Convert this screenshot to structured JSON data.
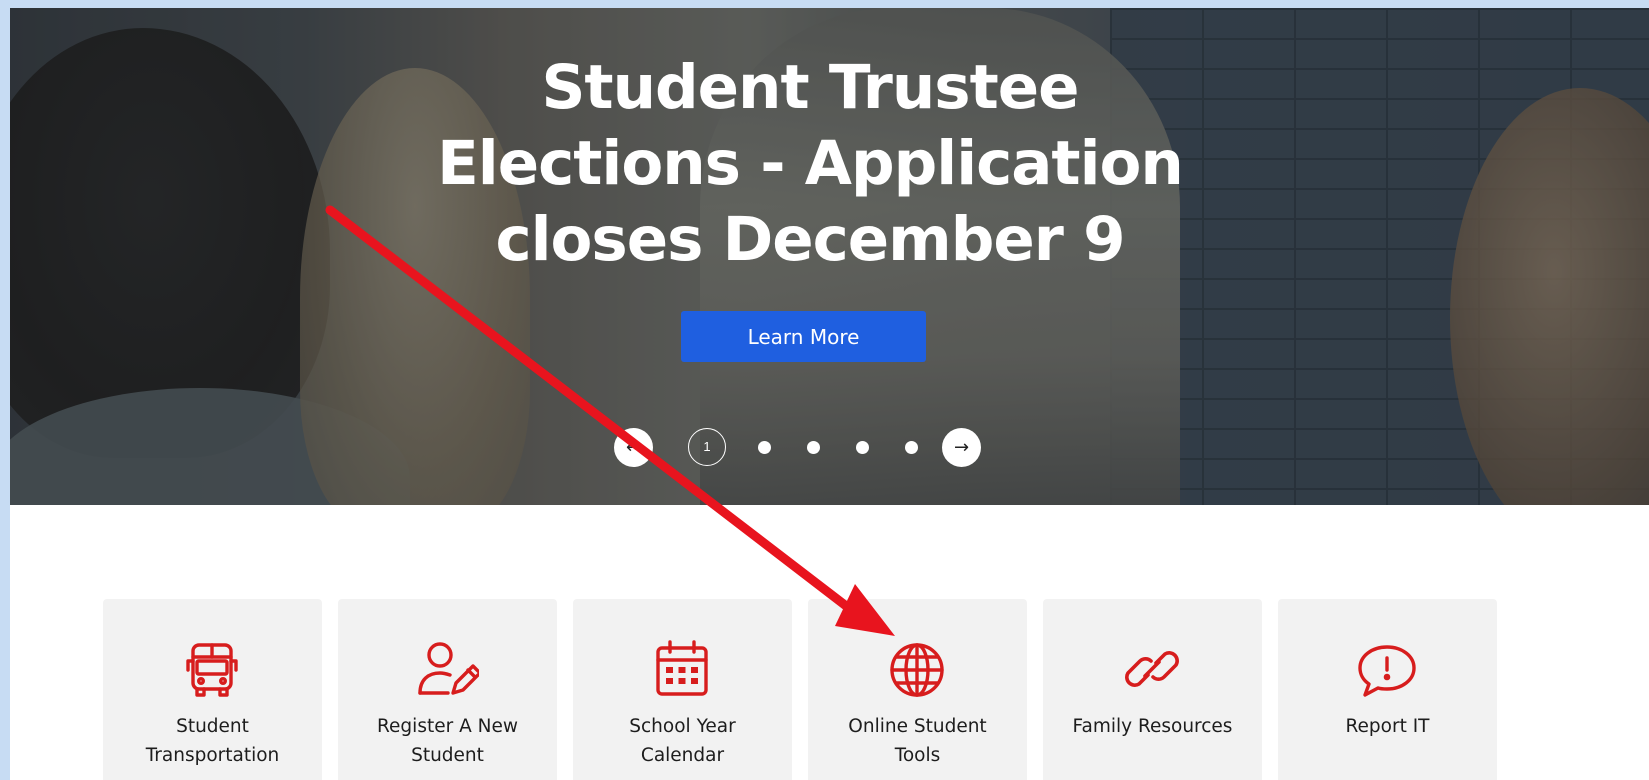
{
  "hero": {
    "title_line1": "Student Trustee",
    "title_line2": "Elections - Application",
    "title_line3": "closes December 9",
    "button_label": "Learn More",
    "prev_arrow": "←",
    "next_arrow": "→",
    "current_page": "1",
    "slide_count": 5
  },
  "tiles": [
    {
      "label_line1": "Student",
      "label_line2": "Transportation",
      "icon": "bus-icon"
    },
    {
      "label_line1": "Register A New",
      "label_line2": "Student",
      "icon": "user-edit-icon"
    },
    {
      "label_line1": "School Year",
      "label_line2": "Calendar",
      "icon": "calendar-icon"
    },
    {
      "label_line1": "Online Student",
      "label_line2": "Tools",
      "icon": "globe-icon"
    },
    {
      "label_line1": "Family Resources",
      "label_line2": "",
      "icon": "link-icon"
    },
    {
      "label_line1": "Report IT",
      "label_line2": "",
      "icon": "speech-bubble-alert-icon"
    }
  ],
  "colors": {
    "accent_red": "#d71d1d",
    "button_blue": "#1f5fe0",
    "tile_bg": "#f2f2f2",
    "annotation_arrow": "#e8141e"
  }
}
